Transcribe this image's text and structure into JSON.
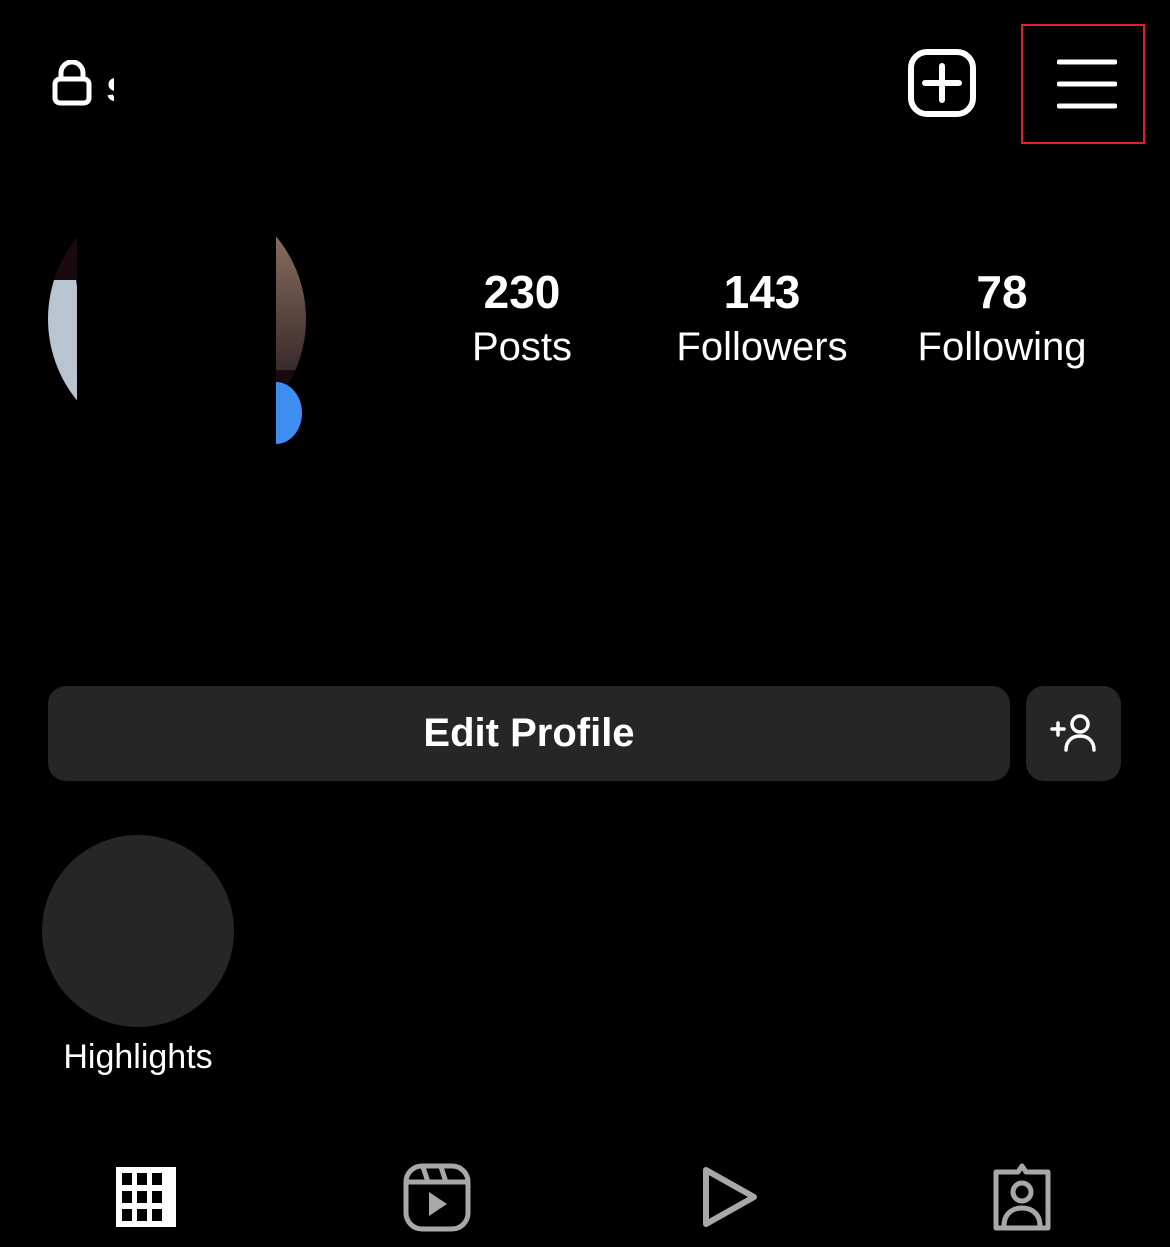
{
  "header": {
    "username": "s",
    "lock_icon": "lock-icon",
    "new_post_icon": "plus-square-icon",
    "menu_icon": "hamburger-menu-icon",
    "highlight_color": "#e0202a"
  },
  "profile": {
    "stats": [
      {
        "count": "230",
        "label": "Posts"
      },
      {
        "count": "143",
        "label": "Followers"
      },
      {
        "count": "78",
        "label": "Following"
      }
    ],
    "story_add_color": "#3d8ef0"
  },
  "actions": {
    "edit_profile": "Edit Profile",
    "discover_people_icon": "add-person-icon"
  },
  "highlights": {
    "label": "Highlights"
  },
  "tabs": [
    {
      "icon": "grid-icon",
      "active": true
    },
    {
      "icon": "reels-icon",
      "active": false
    },
    {
      "icon": "play-icon",
      "active": false
    },
    {
      "icon": "tagged-icon",
      "active": false
    }
  ]
}
